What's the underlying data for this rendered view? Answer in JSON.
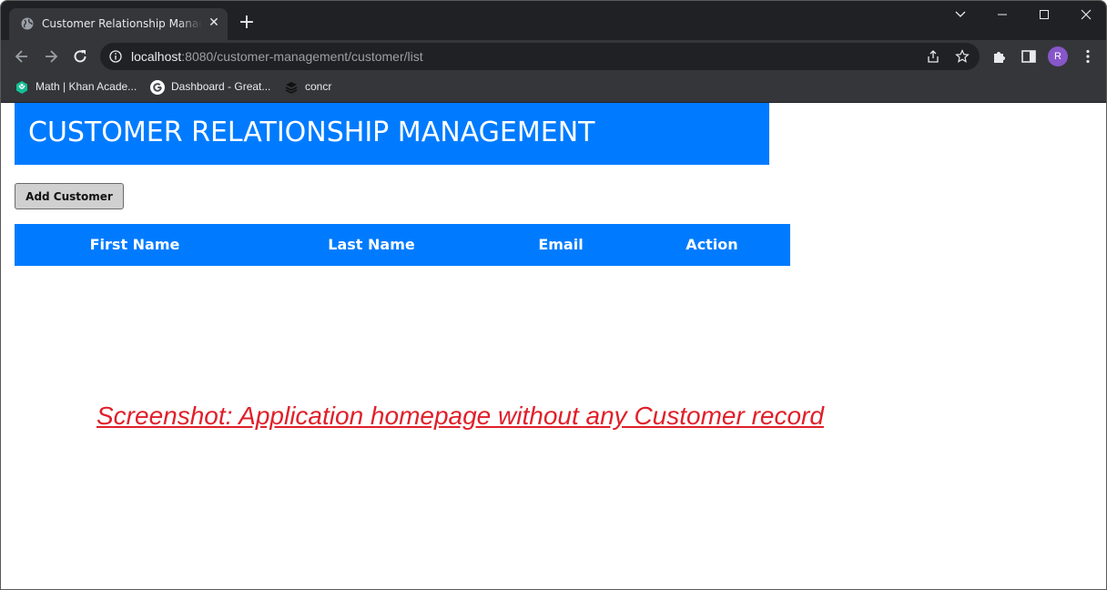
{
  "browser": {
    "tab_title": "Customer Relationship Management",
    "url_host": "localhost",
    "url_rest": ":8080/customer-management/customer/list",
    "profile_initial": "R",
    "bookmarks": [
      {
        "label": "Math | Khan Acade...",
        "icon": "khan-academy-icon"
      },
      {
        "label": "Dashboard - Great...",
        "icon": "google-icon"
      },
      {
        "label": "concr",
        "icon": "layers-icon"
      }
    ]
  },
  "app": {
    "title": "CUSTOMER RELATIONSHIP MANAGEMENT",
    "add_button": "Add Customer",
    "columns": [
      "First Name",
      "Last Name",
      "Email",
      "Action"
    ],
    "rows": []
  },
  "caption": "Screenshot: Application homepage without any Customer record",
  "colors": {
    "header_blue": "#007bff",
    "caption_red": "#e0202a",
    "browser_dark": "#202124",
    "browser_toolbar": "#35363a"
  }
}
